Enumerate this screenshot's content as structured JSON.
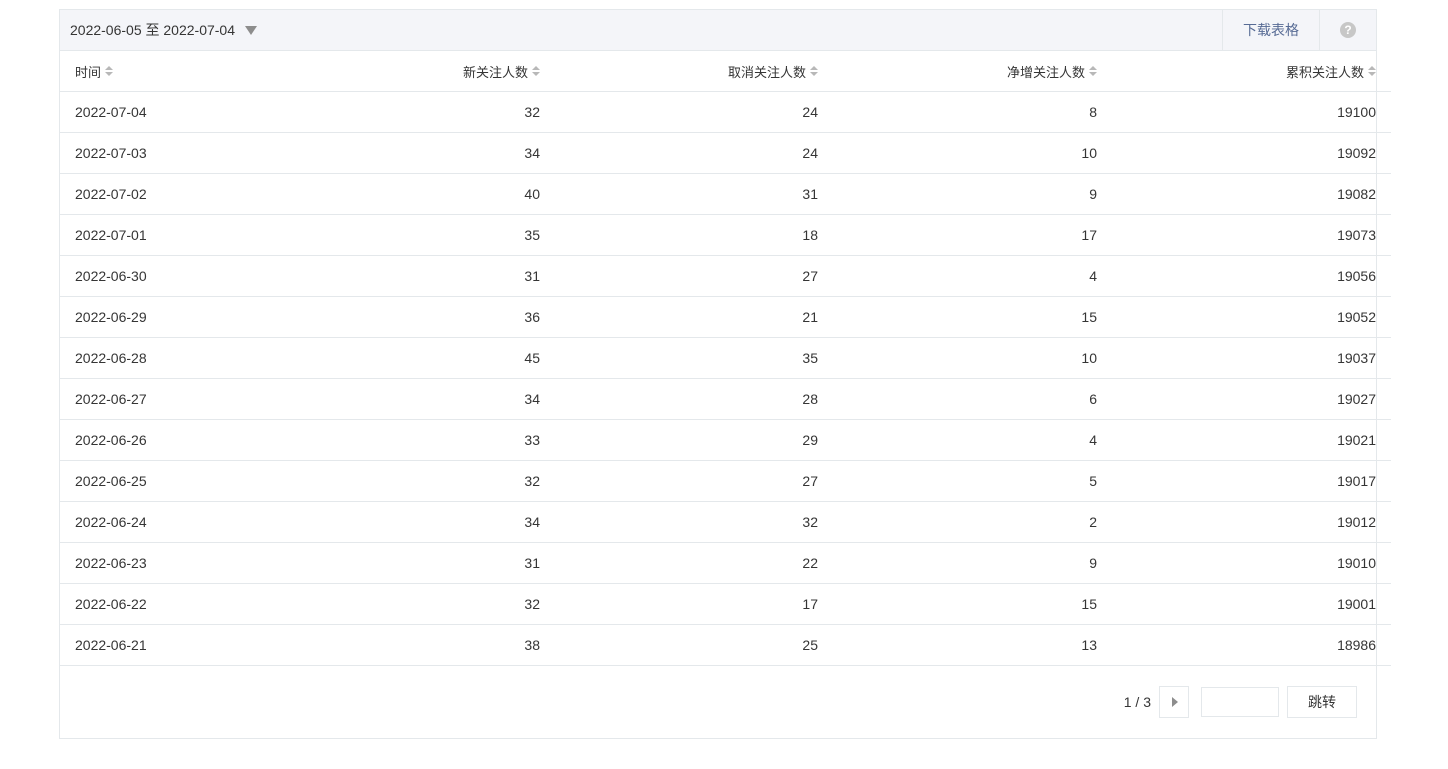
{
  "toolbar": {
    "date_range": "2022-06-05 至 2022-07-04",
    "download_label": "下载表格",
    "help_label": "?"
  },
  "table": {
    "columns": [
      "时间",
      "新关注人数",
      "取消关注人数",
      "净增关注人数",
      "累积关注人数"
    ],
    "rows": [
      [
        "2022-07-04",
        "32",
        "24",
        "8",
        "19100"
      ],
      [
        "2022-07-03",
        "34",
        "24",
        "10",
        "19092"
      ],
      [
        "2022-07-02",
        "40",
        "31",
        "9",
        "19082"
      ],
      [
        "2022-07-01",
        "35",
        "18",
        "17",
        "19073"
      ],
      [
        "2022-06-30",
        "31",
        "27",
        "4",
        "19056"
      ],
      [
        "2022-06-29",
        "36",
        "21",
        "15",
        "19052"
      ],
      [
        "2022-06-28",
        "45",
        "35",
        "10",
        "19037"
      ],
      [
        "2022-06-27",
        "34",
        "28",
        "6",
        "19027"
      ],
      [
        "2022-06-26",
        "33",
        "29",
        "4",
        "19021"
      ],
      [
        "2022-06-25",
        "32",
        "27",
        "5",
        "19017"
      ],
      [
        "2022-06-24",
        "34",
        "32",
        "2",
        "19012"
      ],
      [
        "2022-06-23",
        "31",
        "22",
        "9",
        "19010"
      ],
      [
        "2022-06-22",
        "32",
        "17",
        "15",
        "19001"
      ],
      [
        "2022-06-21",
        "38",
        "25",
        "13",
        "18986"
      ]
    ]
  },
  "pager": {
    "page_info": "1 / 3",
    "input_value": "",
    "jump_label": "跳转"
  },
  "colors": {
    "link": "#576b95",
    "border": "#e4e8eb",
    "toolbar_bg": "#f4f5f9"
  }
}
